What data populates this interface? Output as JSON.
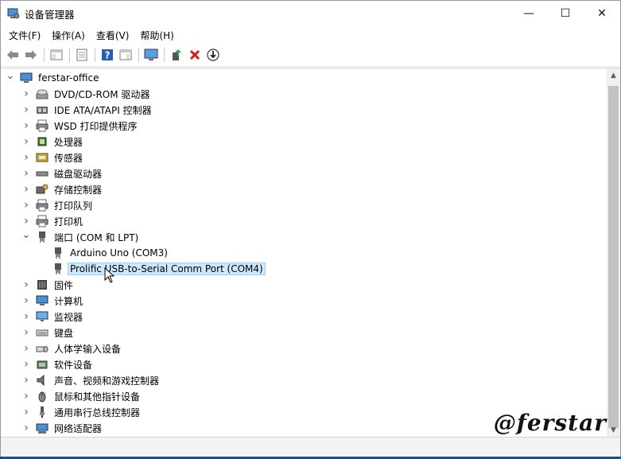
{
  "window": {
    "title": "设备管理器"
  },
  "caption": {
    "minimize": "—",
    "maximize": "☐",
    "close": "✕"
  },
  "menu": [
    "文件(F)",
    "操作(A)",
    "查看(V)",
    "帮助(H)"
  ],
  "tree": {
    "root": "ferstar-office",
    "categories": [
      {
        "label": "DVD/CD-ROM 驱动器",
        "icon": "dvd-drive-icon"
      },
      {
        "label": "IDE ATA/ATAPI 控制器",
        "icon": "ide-controller-icon"
      },
      {
        "label": "WSD 打印提供程序",
        "icon": "printer-icon"
      },
      {
        "label": "处理器",
        "icon": "processor-icon"
      },
      {
        "label": "传感器",
        "icon": "sensor-icon"
      },
      {
        "label": "磁盘驱动器",
        "icon": "disk-drive-icon"
      },
      {
        "label": "存储控制器",
        "icon": "storage-controller-icon"
      },
      {
        "label": "打印队列",
        "icon": "print-queue-icon"
      },
      {
        "label": "打印机",
        "icon": "printer-icon"
      },
      {
        "label": "端口 (COM 和 LPT)",
        "icon": "port-icon",
        "expanded": true,
        "children": [
          {
            "label": "Arduino Uno (COM3)",
            "icon": "port-icon"
          },
          {
            "label": "Prolific USB-to-Serial Comm Port (COM4)",
            "icon": "port-icon",
            "selected": true
          }
        ]
      },
      {
        "label": "固件",
        "icon": "firmware-icon"
      },
      {
        "label": "计算机",
        "icon": "computer-icon"
      },
      {
        "label": "监视器",
        "icon": "monitor-icon"
      },
      {
        "label": "键盘",
        "icon": "keyboard-icon"
      },
      {
        "label": "人体学输入设备",
        "icon": "hid-icon"
      },
      {
        "label": "软件设备",
        "icon": "software-device-icon"
      },
      {
        "label": "声音、视频和游戏控制器",
        "icon": "speaker-icon"
      },
      {
        "label": "鼠标和其他指针设备",
        "icon": "mouse-icon"
      },
      {
        "label": "通用串行总线控制器",
        "icon": "usb-icon"
      },
      {
        "label": "网络适配器",
        "icon": "network-adapter-icon"
      }
    ]
  },
  "watermark": "@ferstar",
  "colors": {
    "selection_bg": "#cce8ff",
    "selection_border": "#99d1ff",
    "close_x": "#d11a1a",
    "help_blue": "#2a5db0"
  }
}
